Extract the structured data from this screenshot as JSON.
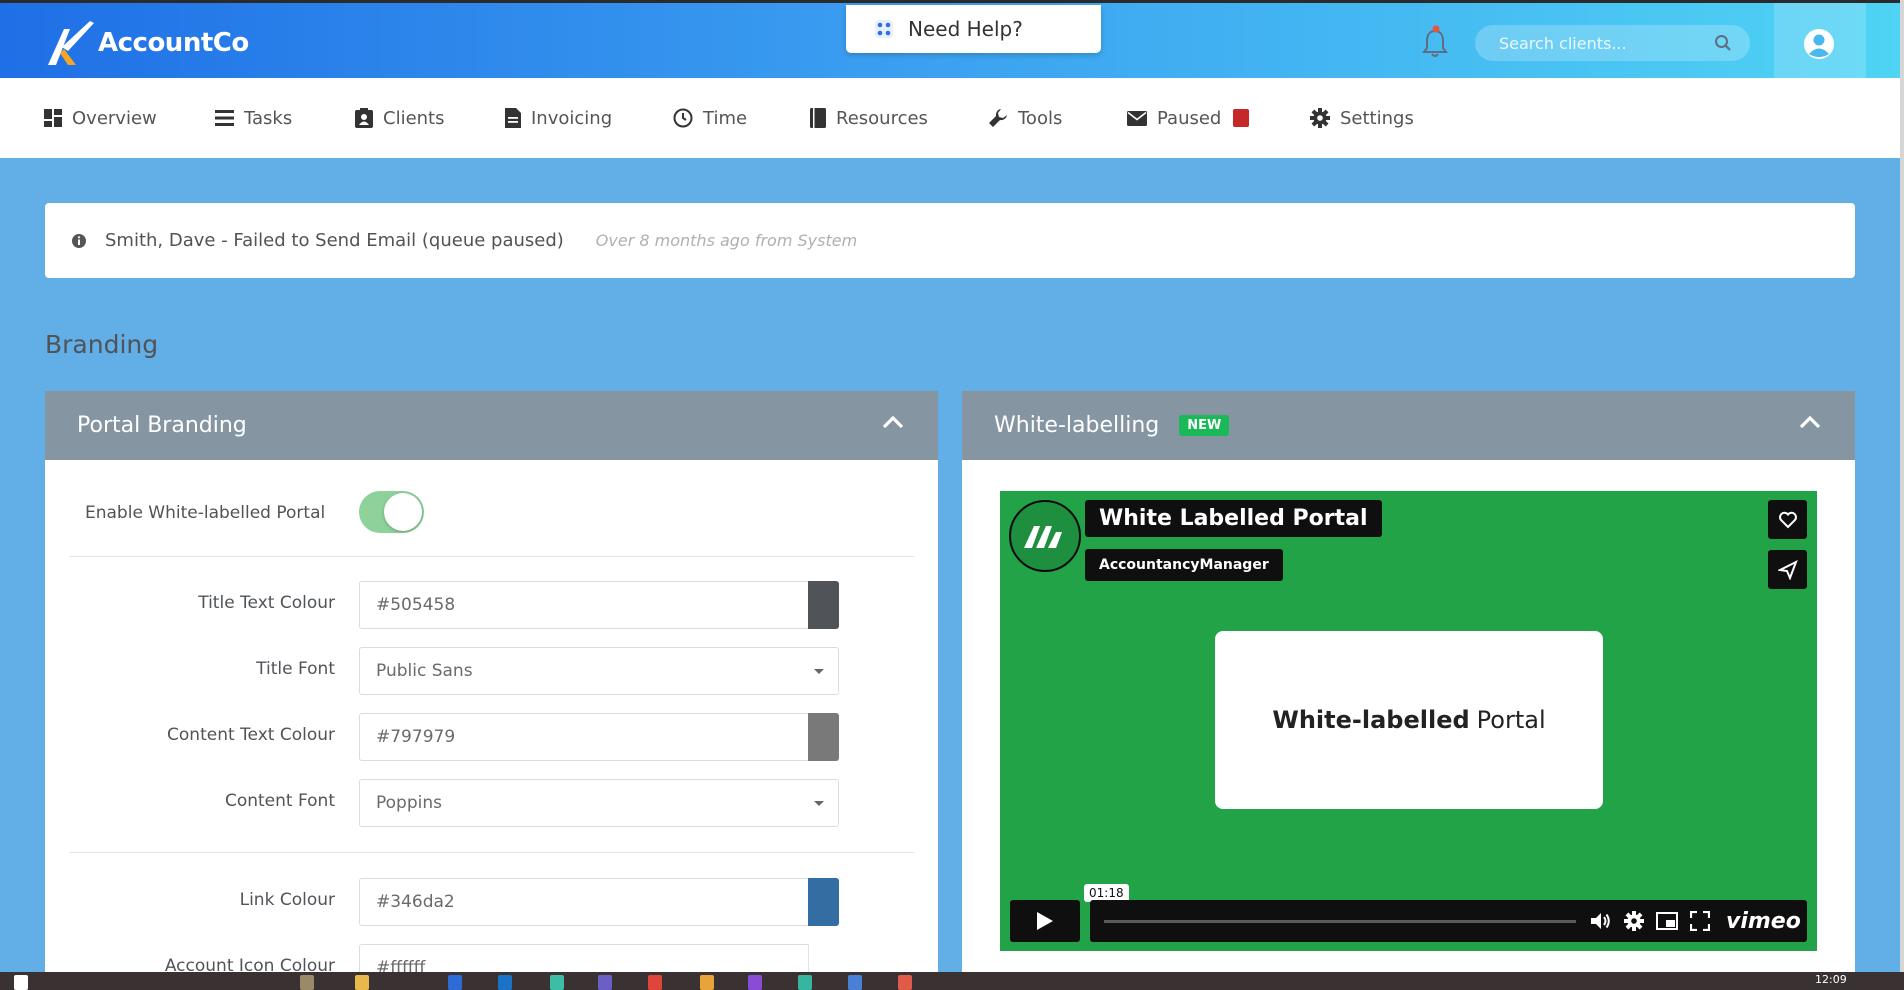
{
  "header": {
    "brand": "AccountCo",
    "help_label": "Need Help?",
    "search_placeholder": "Search clients..."
  },
  "nav": {
    "items": [
      {
        "label": "Overview",
        "icon": "dashboard-icon"
      },
      {
        "label": "Tasks",
        "icon": "tasks-icon"
      },
      {
        "label": "Clients",
        "icon": "clients-icon"
      },
      {
        "label": "Invoicing",
        "icon": "invoice-icon"
      },
      {
        "label": "Time",
        "icon": "clock-icon"
      },
      {
        "label": "Resources",
        "icon": "book-icon"
      },
      {
        "label": "Tools",
        "icon": "wrench-icon"
      },
      {
        "label": "Paused",
        "icon": "envelope-icon"
      },
      {
        "label": "Settings",
        "icon": "gear-icon"
      }
    ]
  },
  "alert": {
    "message": "Smith, Dave - Failed to Send Email (queue paused)",
    "meta": "Over 8 months ago from System"
  },
  "section_title": "Branding",
  "portal_branding": {
    "title": "Portal Branding",
    "enable_label": "Enable White-labelled Portal",
    "enable_value": true,
    "fields": {
      "title_colour_label": "Title Text Colour",
      "title_colour_value": "#505458",
      "title_font_label": "Title Font",
      "title_font_value": "Public Sans",
      "content_colour_label": "Content Text Colour",
      "content_colour_value": "#797979",
      "content_font_label": "Content Font",
      "content_font_value": "Poppins",
      "link_colour_label": "Link Colour",
      "link_colour_value": "#346da2",
      "account_icon_label": "Account Icon Colour",
      "account_icon_value": "#ffffff"
    }
  },
  "white_labelling": {
    "title": "White-labelling",
    "badge": "NEW",
    "video": {
      "title": "White Labelled Portal",
      "byline": "AccountancyManager",
      "card_bold": "White-labelled",
      "card_rest": "Portal",
      "time": "01:18",
      "player": "vimeo"
    }
  },
  "taskbar": {
    "clock": "12:09"
  },
  "colors": {
    "page_bg": "#62aee6",
    "panel_header": "#8595a2",
    "video_bg": "#22a348",
    "paused_badge": "#c62828",
    "new_badge": "#1bb85a"
  }
}
